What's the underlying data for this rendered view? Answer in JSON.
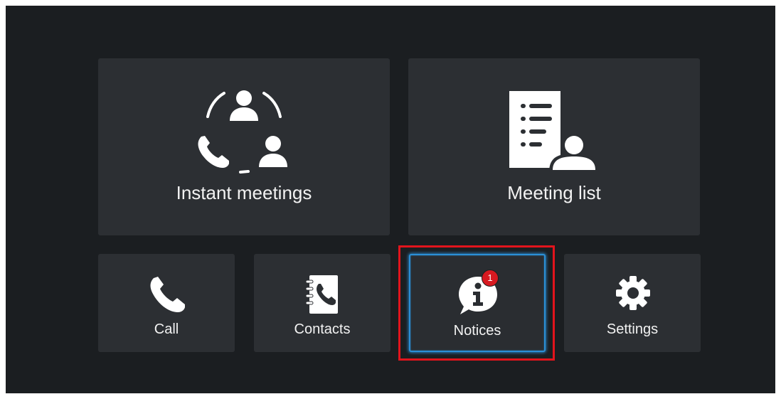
{
  "tiles": {
    "instant_meetings": {
      "label": "Instant meetings",
      "icon": "instant-meeting-icon"
    },
    "meeting_list": {
      "label": "Meeting list",
      "icon": "meeting-list-icon"
    },
    "call": {
      "label": "Call",
      "icon": "phone-icon"
    },
    "contacts": {
      "label": "Contacts",
      "icon": "contacts-book-icon"
    },
    "notices": {
      "label": "Notices",
      "icon": "info-bubble-icon",
      "badge": "1",
      "selected": true
    },
    "settings": {
      "label": "Settings",
      "icon": "gear-icon"
    }
  },
  "colors": {
    "background": "#1b1e21",
    "tile": "#2c2f33",
    "selected_border": "#2b8fd6",
    "highlight_frame": "#e2141c",
    "badge": "#d71920"
  }
}
